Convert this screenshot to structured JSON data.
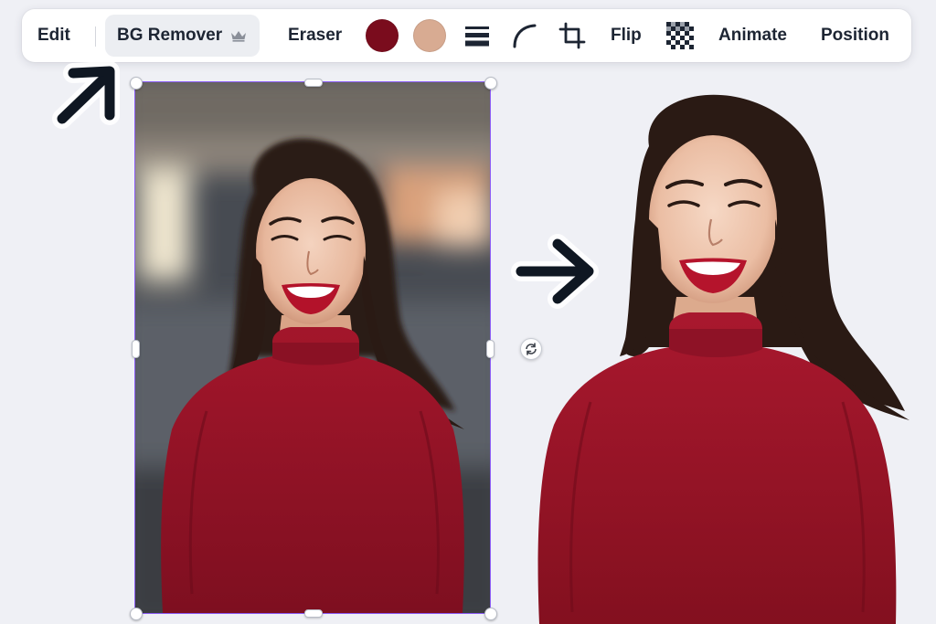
{
  "toolbar": {
    "edit_label": "Edit",
    "bg_remover_label": "BG Remover",
    "bg_remover_badge_icon": "crown-icon",
    "eraser_label": "Eraser",
    "color_swatches": [
      {
        "name": "dark-red",
        "hex": "#7a0c1d"
      },
      {
        "name": "skin-beige",
        "hex": "#d8ab92"
      }
    ],
    "icons": [
      "line-weight-icon",
      "corner-rounding-icon",
      "crop-icon",
      "transparency-icon"
    ],
    "flip_label": "Flip",
    "animate_label": "Animate",
    "position_label": "Position"
  },
  "canvas": {
    "annotation_arrows": [
      "arrow-up-right-icon",
      "arrow-right-icon"
    ],
    "selection_color": "#8b5cf6",
    "rotate_icon": "rotate-icon",
    "sweater_color": "#9b1428",
    "hair_color": "#2a1a14"
  }
}
